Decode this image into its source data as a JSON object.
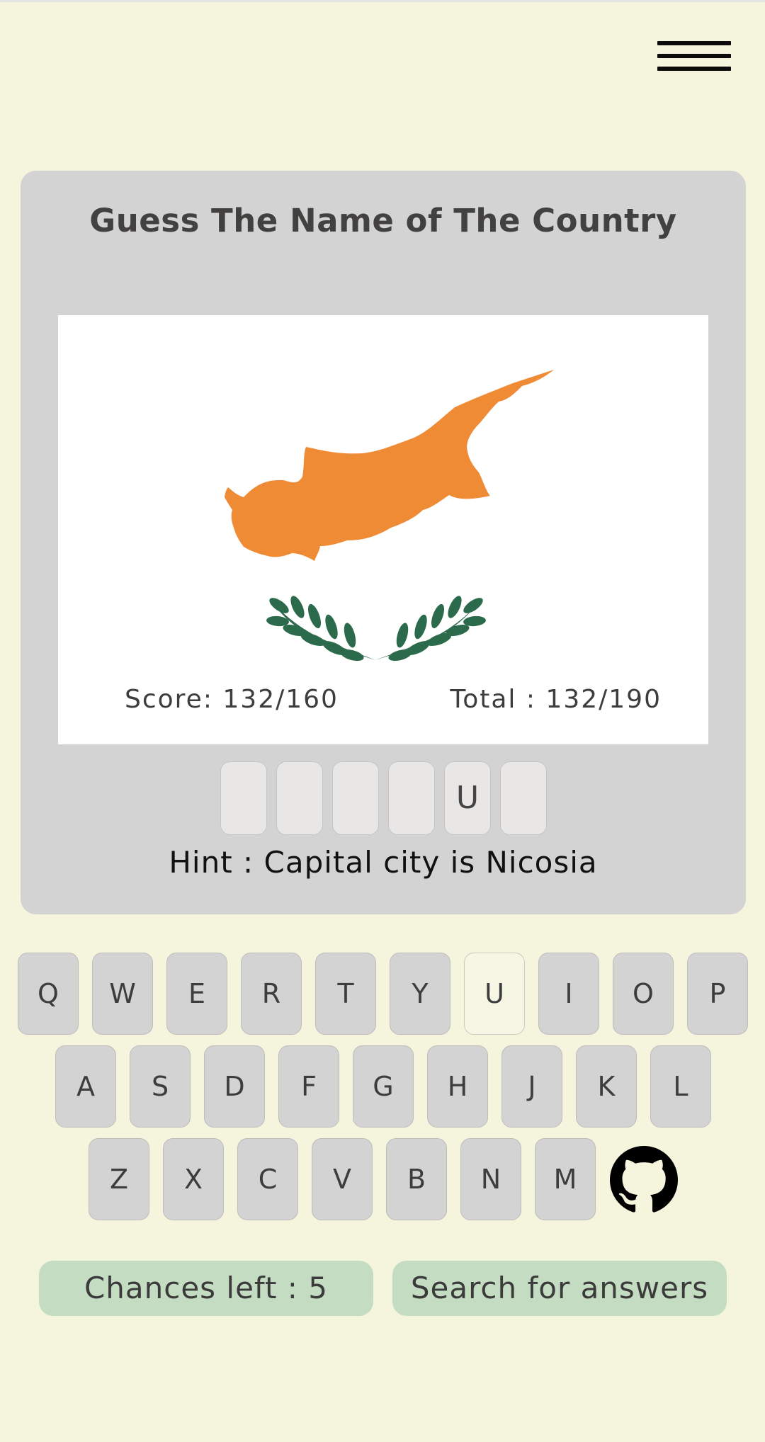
{
  "page": {
    "title": "Guess The Name of The Country",
    "colors": {
      "background": "#f5f5de",
      "card": "#d3d3d3",
      "map": "#ef8a35",
      "olive": "#2c6a4c",
      "pill": "#c4dcc1"
    }
  },
  "menu": {
    "icon": "hamburger-menu-icon"
  },
  "flag": {
    "country_depicted": "cyprus-flag"
  },
  "score": {
    "label": "Score: 132/160"
  },
  "total": {
    "label": "Total : 132/190"
  },
  "answer_slots": [
    "",
    "",
    "",
    "",
    "U",
    ""
  ],
  "hint": {
    "text": "Hint : Capital city is Nicosia"
  },
  "keyboard": {
    "row1": [
      "Q",
      "W",
      "E",
      "R",
      "T",
      "Y",
      "U",
      "I",
      "O",
      "P"
    ],
    "row2": [
      "A",
      "S",
      "D",
      "F",
      "G",
      "H",
      "J",
      "K",
      "L"
    ],
    "row3": [
      "Z",
      "X",
      "C",
      "V",
      "B",
      "N",
      "M"
    ],
    "used": [
      "U"
    ]
  },
  "github": {
    "icon": "github-icon"
  },
  "chances": {
    "label": "Chances left : 5"
  },
  "search": {
    "label": "Search for answers"
  }
}
